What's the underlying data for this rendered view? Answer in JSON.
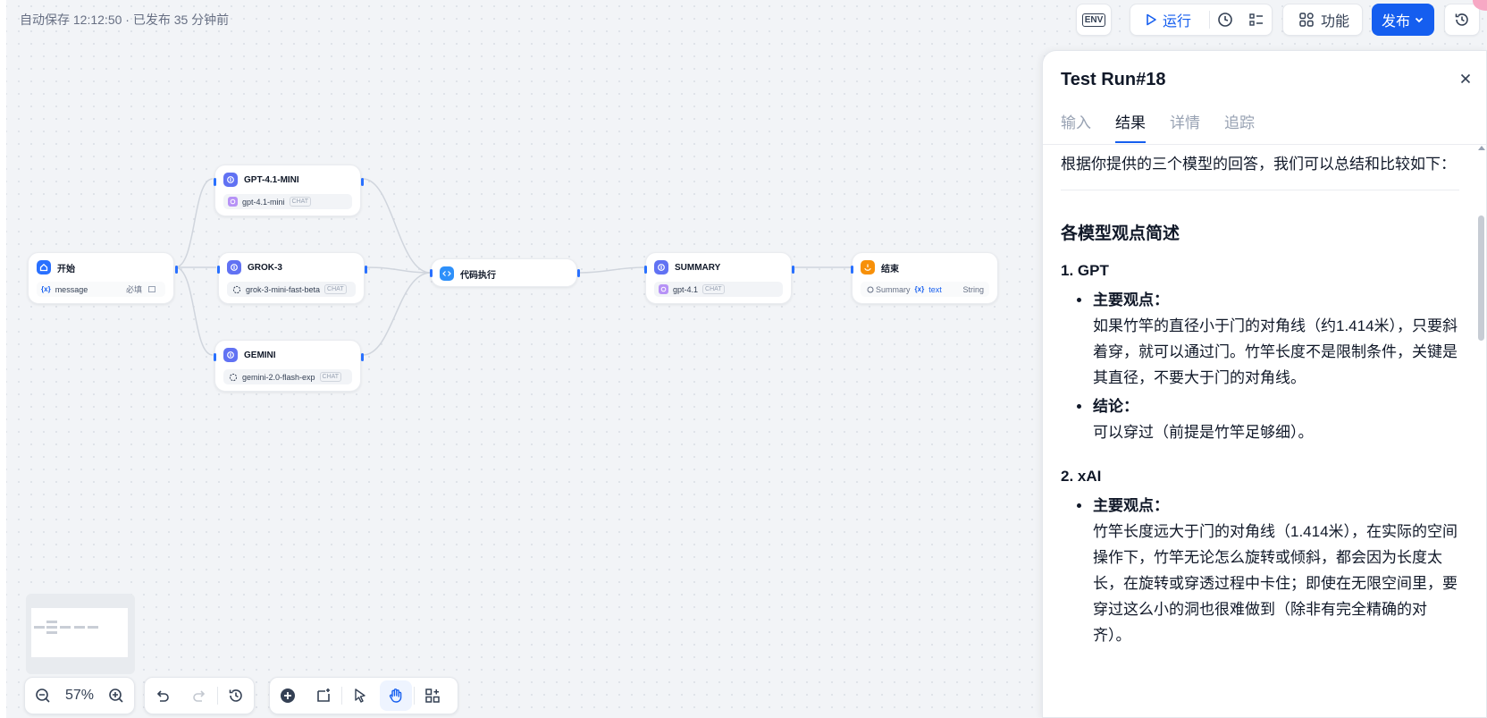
{
  "header": {
    "autosave": "自动保存 12:12:50 · 已发布 35 分钟前",
    "env_label": "ENV",
    "run_label": "运行",
    "features_label": "功能",
    "publish_label": "发布"
  },
  "nodes": {
    "start": {
      "title": "开始",
      "var_name": "message",
      "required": "必填"
    },
    "gpt": {
      "title": "GPT-4.1-MINI",
      "model": "gpt-4.1-mini",
      "tag": "CHAT"
    },
    "grok": {
      "title": "GROK-3",
      "model": "grok-3-mini-fast-beta",
      "tag": "CHAT"
    },
    "gemini": {
      "title": "GEMINI",
      "model": "gemini-2.0-flash-exp",
      "tag": "CHAT"
    },
    "code": {
      "title": "代码执行"
    },
    "summary": {
      "title": "SUMMARY",
      "model": "gpt-4.1",
      "tag": "CHAT"
    },
    "end": {
      "title": "结束",
      "source": "Summary",
      "var": "text",
      "type": "String"
    }
  },
  "controls": {
    "zoom": "57%"
  },
  "panel": {
    "title": "Test Run#18",
    "tabs": [
      "输入",
      "结果",
      "详情",
      "追踪"
    ],
    "active_tab": 1,
    "intro": "根据你提供的三个模型的回答，我们可以总结和比较如下：",
    "section_title": "各模型观点简述",
    "gpt_heading": "1. GPT",
    "gpt_main_label": "主要观点：",
    "gpt_main_text": "如果竹竿的直径小于门的对角线（约1.414米），只要斜着穿，就可以通过门。竹竿长度不是限制条件，关键是其直径，不要大于门的对角线。",
    "gpt_conclusion_label": "结论：",
    "gpt_conclusion_text": "可以穿过（前提是竹竿足够细）。",
    "xai_heading": "2. xAI",
    "xai_main_label": "主要观点：",
    "xai_main_text": "竹竿长度远大于门的对角线（1.414米），在实际的空间操作下，竹竿无论怎么旋转或倾斜，都会因为长度太长，在旋转或穿透过程中卡住；即使在无限空间里，要穿过这么小的洞也很难做到（除非有完全精确的对齐）。"
  }
}
